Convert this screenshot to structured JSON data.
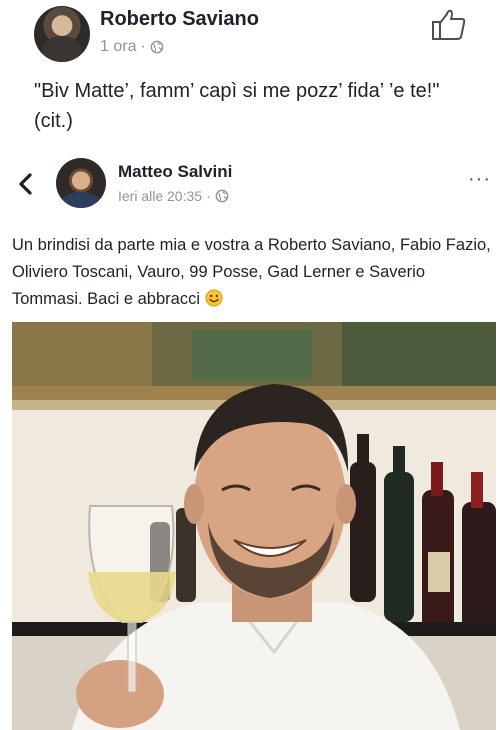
{
  "outer_post": {
    "author": "Roberto Saviano",
    "time": "1 ora",
    "separator": "·",
    "status_text": "\"Biv Matte’, famm’ capì si me pozz’ fida’ ’e te!\" (cit.)"
  },
  "shared_post": {
    "author": "Matteo Salvini",
    "time": "Ieri alle 20:35",
    "separator": "·",
    "status_text": "Un brindisi da parte mia e vostra a Roberto Saviano, Fabio Fazio, Oliviero Toscani, Vauro, 99 Posse, Gad Lerner e Saverio Tommasi. Baci e abbracci",
    "more_label": "···"
  },
  "icons": {
    "like": "thumbs-up-icon",
    "privacy": "globe-icon",
    "back": "chevron-left-icon",
    "emoji": "smiley-icon"
  },
  "colors": {
    "text": "#1d2129",
    "meta": "#90949c",
    "icon": "#4b4f56"
  }
}
